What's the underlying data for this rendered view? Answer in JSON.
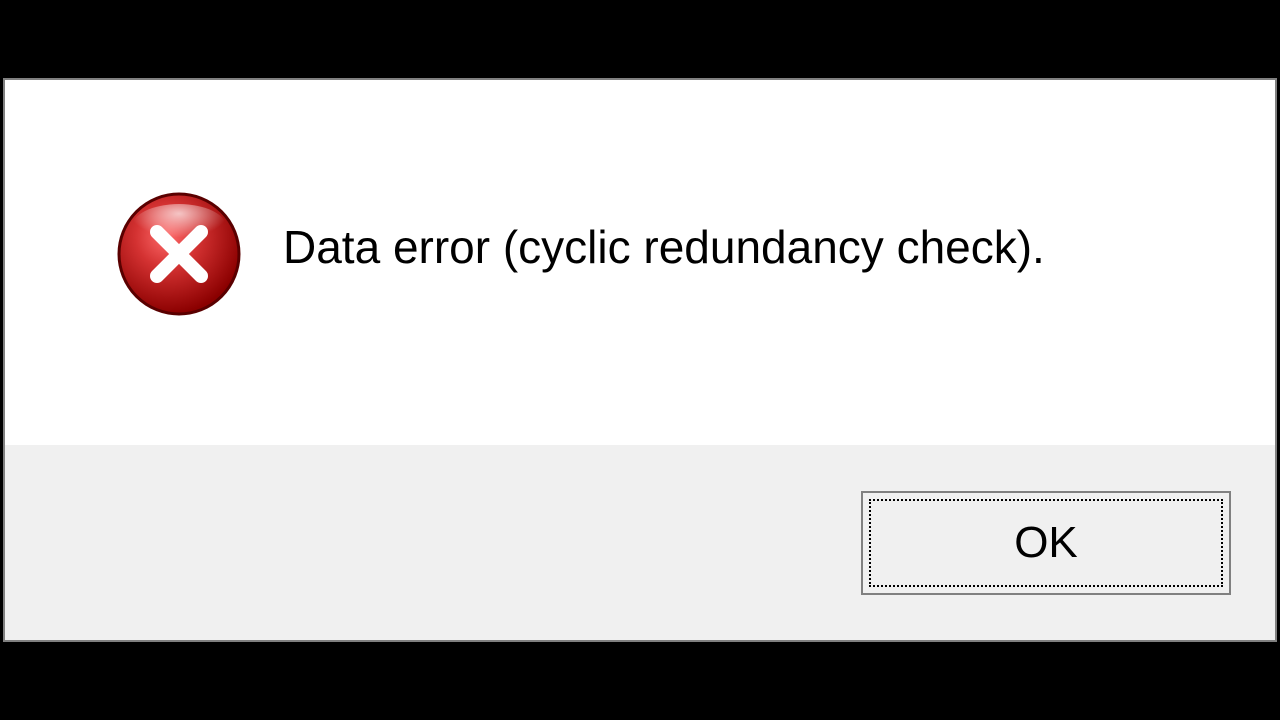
{
  "dialog": {
    "message": "Data error (cyclic redundancy check).",
    "ok_label": "OK"
  }
}
